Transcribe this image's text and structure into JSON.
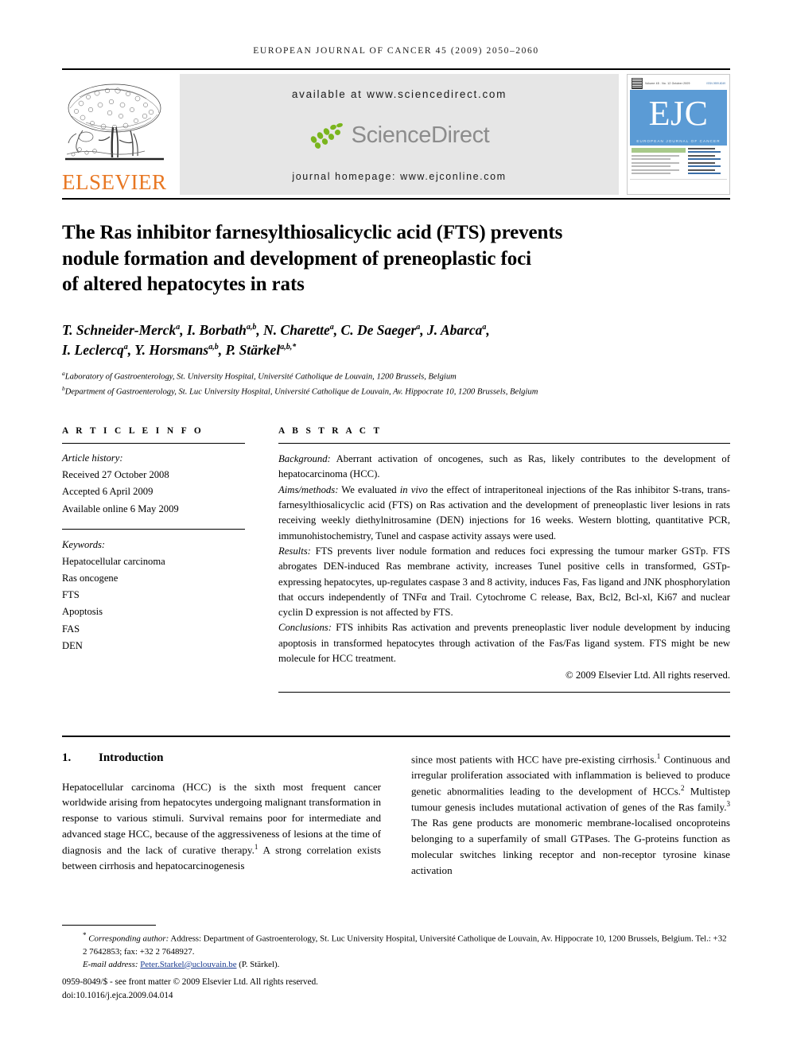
{
  "running_head": "EUROPEAN JOURNAL OF CANCER 45 (2009) 2050–2060",
  "banner": {
    "publisher_wordmark": "ELSEVIER",
    "available_at": "available at www.sciencedirect.com",
    "sciencedirect_word": "ScienceDirect",
    "journal_homepage": "journal homepage: www.ejconline.com",
    "cover": {
      "logo_letters": "EJC",
      "journal_name": "EUROPEAN JOURNAL OF CANCER",
      "top_left_label": "ELSEVIER",
      "top_center_label": "Volume 45 . No. 12 October 2009",
      "top_right_label": "ISSN 0959-8049",
      "item_1": "Prognostic markers for prostate cancer",
      "item_2": "Colorectal cancer surgery in Europe",
      "item_3": "Breast screening surgery and mammography after a BRCA mutation in a carrier",
      "side_1_label": "Editorial",
      "side_1_text": "European Organisation for Research and Treatment of Cancer",
      "side_2_label": "News",
      "side_2_text": "European School of Oncology",
      "side_3_label": "Reviews",
      "side_3_text": "European Association for Cancer Research",
      "side_4_label": "Policy",
      "side_4_text": "Federation of European Cancer Societies",
      "side_5_label": "Editorial",
      "side_5_text": "European Society of Mastology"
    }
  },
  "article": {
    "title_line_1": "The Ras inhibitor farnesylthiosalicyclic acid (FTS) prevents",
    "title_line_2": "nodule formation and development of preneoplastic foci",
    "title_line_3": "of altered hepatocytes in rats",
    "authors_line_1_parts": [
      {
        "name": "T. Schneider-Merck",
        "sup": "a"
      },
      {
        "name": "I. Borbath",
        "sup": "a,b"
      },
      {
        "name": "N. Charette",
        "sup": "a"
      },
      {
        "name": "C. De Saeger",
        "sup": "a"
      },
      {
        "name": "J. Abarca",
        "sup": "a"
      }
    ],
    "authors_line_2_parts": [
      {
        "name": "I. Leclercq",
        "sup": "a"
      },
      {
        "name": "Y. Horsmans",
        "sup": "a,b"
      },
      {
        "name": "P. Stärkel",
        "sup": "a,b,*"
      }
    ],
    "affiliation_a_marker": "a",
    "affiliation_a": "Laboratory of Gastroenterology, St. University Hospital, Université Catholique de Louvain, 1200 Brussels, Belgium",
    "affiliation_b_marker": "b",
    "affiliation_b": "Department of Gastroenterology, St. Luc University Hospital, Université Catholique de Louvain, Av. Hippocrate 10, 1200 Brussels, Belgium"
  },
  "article_info": {
    "heading": "A R T I C L E   I N F O",
    "history_label": "Article history:",
    "history": [
      "Received 27 October 2008",
      "Accepted 6 April 2009",
      "Available online 6 May 2009"
    ],
    "keywords_label": "Keywords:",
    "keywords": [
      "Hepatocellular carcinoma",
      "Ras oncogene",
      "FTS",
      "Apoptosis",
      "FAS",
      "DEN"
    ]
  },
  "abstract": {
    "heading": "A B S T R A C T",
    "background_label": "Background:",
    "background_text": " Aberrant activation of oncogenes, such as Ras, likely contributes to the development of hepatocarcinoma (HCC).",
    "aims_label": "Aims/methods:",
    "aims_text_1": " We evaluated ",
    "aims_italic": "in vivo",
    "aims_text_2": " the effect of intraperitoneal injections of the Ras inhibitor S-trans, trans-farnesylthiosalicyclic acid (FTS) on Ras activation and the development of preneoplastic liver lesions in rats receiving weekly diethylnitrosamine (DEN) injections for 16 weeks. Western blotting, quantitative PCR, immunohistochemistry, Tunel and caspase activity assays were used.",
    "results_label": "Results:",
    "results_text": " FTS prevents liver nodule formation and reduces foci expressing the tumour marker GSTp. FTS abrogates DEN-induced Ras membrane activity, increases Tunel positive cells in transformed, GSTp-expressing hepatocytes, up-regulates caspase 3 and 8 activity, induces Fas, Fas ligand and JNK phosphorylation that occurs independently of TNFα and Trail. Cytochrome C release, Bax, Bcl2, Bcl-xl, Ki67 and nuclear cyclin D expression is not affected by FTS.",
    "conclusions_label": "Conclusions:",
    "conclusions_text": " FTS inhibits Ras activation and prevents preneoplastic liver nodule development by inducing apoptosis in transformed hepatocytes through activation of the Fas/Fas ligand system. FTS might be new molecule for HCC treatment.",
    "copyright": "© 2009 Elsevier Ltd. All rights reserved."
  },
  "introduction": {
    "number": "1.",
    "heading": "Introduction",
    "left_text_1": "Hepatocellular carcinoma (HCC) is the sixth most frequent cancer worldwide arising from hepatocytes undergoing malignant transformation in response to various stimuli. Survival remains poor for intermediate and advanced stage HCC, because of the aggressiveness of lesions at the time of diagnosis and the lack of curative therapy.",
    "left_ref_1": "1",
    "left_text_2": " A strong correlation exists between cirrhosis and hepatocarcinogenesis",
    "right_text_1": "since most patients with HCC have pre-existing cirrhosis.",
    "right_ref_1": "1",
    "right_text_2": " Continuous and irregular proliferation associated with inflammation is believed to produce genetic abnormalities leading to the development of HCCs.",
    "right_ref_2": "2",
    "right_text_3": " Multistep tumour genesis includes mutational activation of genes of the Ras family.",
    "right_ref_3": "3",
    "right_text_4": " The Ras gene products are monomeric membrane-localised oncoproteins belonging to a superfamily of small GTPases. The G-proteins function as molecular switches linking receptor and non-receptor tyrosine kinase activation"
  },
  "footer": {
    "corresponding_marker": "*",
    "corresponding_label": "Corresponding author:",
    "corresponding_text": " Address: Department of Gastroenterology, St. Luc University Hospital, Université Catholique de Louvain, Av. Hippocrate 10, 1200 Brussels, Belgium. Tel.: +32 2 7642853; fax: +32 2 7648927.",
    "email_label": "E-mail address:",
    "email_address": "Peter.Starkel@uclouvain.be",
    "email_person": " (P. Stärkel).",
    "issn_line": "0959-8049/$ - see front matter © 2009 Elsevier Ltd. All rights reserved.",
    "doi_line": "doi:10.1016/j.ejca.2009.04.014"
  },
  "colors": {
    "elsevier_orange": "#E87722",
    "sciencedirect_green": "#7AB51D",
    "sciencedirect_gray": "#8C8C8C",
    "cover_blue": "#5B9BD5",
    "banner_gray": "#E6E6E6",
    "link_blue": "#1A3A8F"
  }
}
